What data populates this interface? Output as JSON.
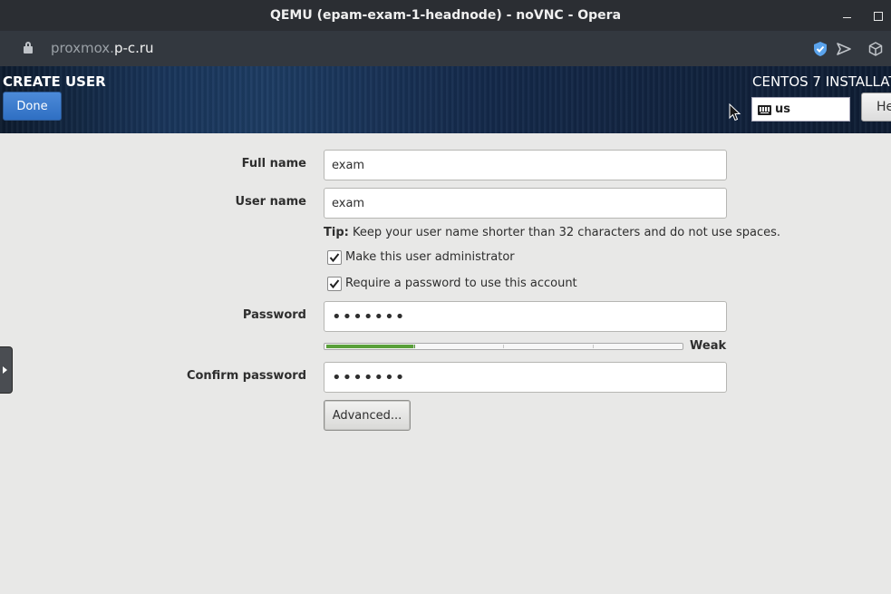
{
  "browser": {
    "window_title": "QEMU (epam-exam-1-headnode) - noVNC - Opera",
    "url_prefix": "proxmox.",
    "url_domain": "p-c.ru"
  },
  "installer": {
    "spoke_title": "CREATE USER",
    "done_label": "Done",
    "product_title": "CENTOS 7 INSTALLAT",
    "keyboard_layout": "us",
    "help_label": "He"
  },
  "form": {
    "full_name_label": "Full name",
    "full_name_value": "exam",
    "user_name_label": "User name",
    "user_name_value": "exam",
    "tip_bold": "Tip:",
    "tip_text": " Keep your user name shorter than 32 characters and do not use spaces.",
    "admin_checkbox_label": "Make this user administrator",
    "admin_checked": true,
    "require_password_label": "Require a password to use this account",
    "require_password_checked": true,
    "password_label": "Password",
    "password_mask": "•••••••",
    "strength_label": "Weak",
    "strength_fraction": 0.25,
    "confirm_password_label": "Confirm password",
    "confirm_password_mask": "•••••••",
    "advanced_label": "Advanced..."
  },
  "colors": {
    "strength_weak": "#59a03a",
    "done_button": "#3b7bce",
    "header_bg": "#1a3558"
  },
  "icons": [
    "lock-icon",
    "shield-icon",
    "send-icon",
    "cube-icon",
    "keyboard-icon",
    "mouse-cursor",
    "checkmark-icon",
    "expand-arrow-icon"
  ]
}
